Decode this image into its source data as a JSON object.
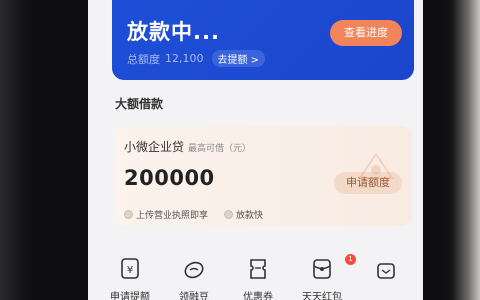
{
  "loan": {
    "status": "放款中...",
    "progress_button": "查看进度",
    "total_label": "总额度",
    "total_amount": "12,100",
    "withdraw_chip": "去提额 >"
  },
  "section": {
    "title": "大额借款"
  },
  "product": {
    "name": "小微企业贷",
    "sub": "最高可借（元）",
    "amount": "200000",
    "apply_button": "申请额度",
    "perks": [
      "上传营业执照即享",
      "放款快"
    ]
  },
  "nav": {
    "items": [
      {
        "label": "申请提额",
        "icon": "yen-card-icon"
      },
      {
        "label": "领融豆",
        "icon": "bean-icon"
      },
      {
        "label": "优惠券",
        "icon": "coupon-icon"
      },
      {
        "label": "天天红包",
        "icon": "red-envelope-icon",
        "badge": "1"
      },
      {
        "label": "",
        "icon": "gift-icon"
      }
    ]
  },
  "colors": {
    "primary_blue": "#1f4fd8",
    "accent_orange": "#f2845a",
    "card_beige": "#fbf3ec",
    "badge_red": "#f24d3d"
  }
}
